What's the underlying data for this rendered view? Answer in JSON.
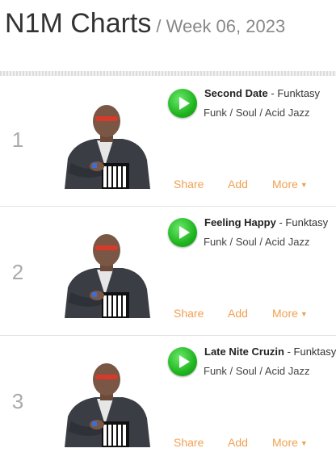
{
  "header": {
    "title": "N1M Charts",
    "subtitle": "/ Week 06, 2023"
  },
  "rows": [
    {
      "rank": "1",
      "title": "Second Date",
      "dash": " - ",
      "artist": "Funktasy",
      "genre": "Funk / Soul / Acid Jazz",
      "share": "Share",
      "add": "Add",
      "more": "More"
    },
    {
      "rank": "2",
      "title": "Feeling Happy",
      "dash": " - ",
      "artist": "Funktasy",
      "genre": "Funk / Soul / Acid Jazz",
      "share": "Share",
      "add": "Add",
      "more": "More"
    },
    {
      "rank": "3",
      "title": "Late Nite Cruzin",
      "dash": " - ",
      "artist": "Funktasy",
      "genre": "Funk / Soul / Acid Jazz",
      "share": "Share",
      "add": "Add",
      "more": "More"
    }
  ],
  "colors": {
    "accent": "#f0a050",
    "play": "#1fb51f",
    "rank": "#aaaaaa"
  },
  "icons": {
    "play": "play-icon",
    "more": "caret-down-icon"
  }
}
